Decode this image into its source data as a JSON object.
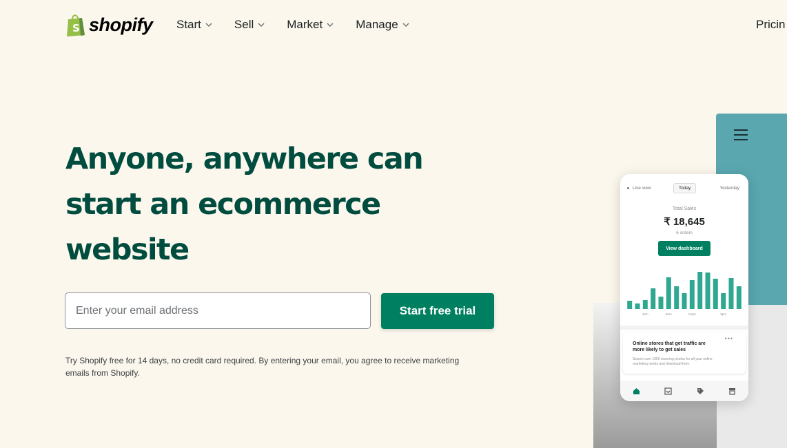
{
  "header": {
    "logo_text": "shopify",
    "nav": [
      {
        "label": "Start"
      },
      {
        "label": "Sell"
      },
      {
        "label": "Market"
      },
      {
        "label": "Manage"
      }
    ],
    "pricing_label": "Pricin"
  },
  "hero": {
    "headline_line1": "Anyone, anywhere can",
    "headline_line2": "start an ecommerce",
    "headline_line3": "website",
    "email_placeholder": "Enter your email address",
    "cta_label": "Start free trial",
    "disclaimer": "Try Shopify free for 14 days, no credit card required. By entering your email, you agree to receive marketing emails from Shopify."
  },
  "phone": {
    "tab_live": "Live view",
    "tab_today": "Today",
    "tab_yesterday": "Yesterday",
    "total_label": "Total Sales",
    "total_value": "₹ 18,645",
    "orders": "6 orders",
    "button_label": "View dashboard",
    "bar_values": [
      12,
      8,
      13,
      30,
      18,
      46,
      33,
      23,
      42,
      54,
      53,
      44,
      23,
      45,
      33
    ],
    "x_ticks": [
      "4am",
      "8am",
      "12pm",
      "8pm"
    ],
    "card_title": "Online stores that get traffic are more likely to get sales",
    "card_body": "Search over 1000 stunning photos for all your online marketing needs and download them.",
    "bottom_icons": [
      "home-icon",
      "orders-icon",
      "tag-icon",
      "store-icon"
    ]
  },
  "colors": {
    "background": "#fbf7ed",
    "headline": "#004c3f",
    "brand_green": "#008060",
    "logo_green": "#95bf47",
    "teal_panel": "#5aa7b0",
    "chart_bars": "#2fa791"
  }
}
